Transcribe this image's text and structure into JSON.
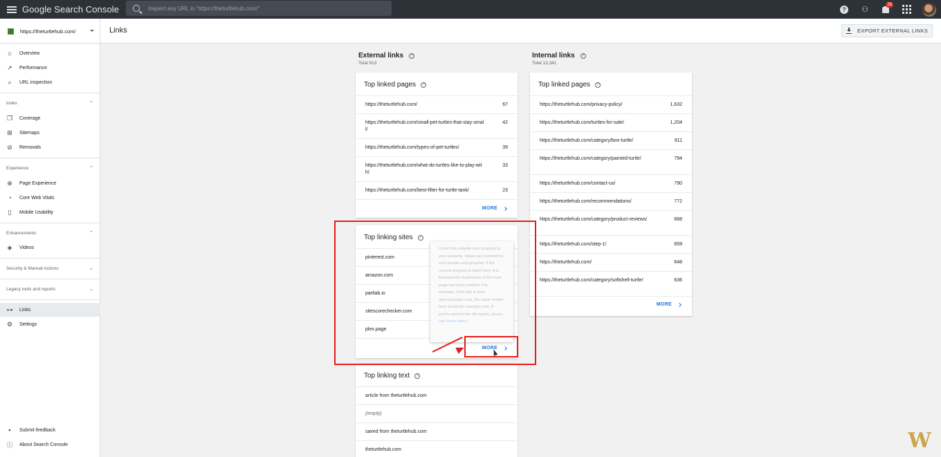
{
  "app": {
    "brand": "Google Search Console",
    "search_placeholder": "Inspect any URL in \"https://theturtlehub.com/\"",
    "notification_count": "28"
  },
  "property": "https://theturtlehub.com/",
  "page_title": "Links",
  "export_label": "EXPORT EXTERNAL LINKS",
  "sidebar": {
    "top_items": [
      {
        "label": "Overview",
        "icon": "home-icon"
      },
      {
        "label": "Performance",
        "icon": "trending-icon"
      },
      {
        "label": "URL inspection",
        "icon": "search-icon"
      }
    ],
    "sections": [
      {
        "title": "Index",
        "items": [
          "Coverage",
          "Sitemaps",
          "Removals"
        ]
      },
      {
        "title": "Experience",
        "items": [
          "Page Experience",
          "Core Web Vitals",
          "Mobile Usability"
        ]
      },
      {
        "title": "Enhancements",
        "items": [
          "Videos"
        ]
      }
    ],
    "collapsed_sections": [
      "Security & Manual Actions",
      "Legacy tools and reports"
    ],
    "bottom_items": [
      "Links",
      "Settings"
    ],
    "footer_items": [
      "Submit feedback",
      "About Search Console"
    ]
  },
  "external": {
    "title": "External links",
    "total": "Total 913",
    "top_linked_pages": {
      "title": "Top linked pages",
      "rows": [
        {
          "url": "https://theturtlehub.com/",
          "count": "67"
        },
        {
          "url": "https://theturtlehub.com/small-pet-turtles-that-stay-small/",
          "count": "42"
        },
        {
          "url": "https://theturtlehub.com/types-of-pet-turtles/",
          "count": "39"
        },
        {
          "url": "https://theturtlehub.com/what-do-turtles-like-to-play-with/",
          "count": "33"
        },
        {
          "url": "https://theturtlehub.com/best-filter-for-turtle-tank/",
          "count": "23"
        }
      ]
    },
    "top_linking_sites": {
      "title": "Top linking sites",
      "rows": [
        "pinterest.com",
        "amazon.com",
        "partlab.io",
        "sitescorechecker.com",
        "plex.page"
      ]
    },
    "top_linking_text": {
      "title": "Top linking text",
      "rows": [
        "article from theturtlehub.com",
        "(empty)",
        "saved from theturtlehub.com",
        "theturtlehub.com"
      ]
    }
  },
  "internal": {
    "title": "Internal links",
    "total": "Total 13,341",
    "top_linked_pages": {
      "title": "Top linked pages",
      "rows": [
        {
          "url": "https://theturtlehub.com/privacy-policy/",
          "count": "1,632"
        },
        {
          "url": "https://theturtlehub.com/turtles-for-sale/",
          "count": "1,204"
        },
        {
          "url": "https://theturtlehub.com/category/box-turtle/",
          "count": "811"
        },
        {
          "url": "https://theturtlehub.com/category/painted-turtle/",
          "count": "794"
        },
        {
          "url": "https://theturtlehub.com/contact-us/",
          "count": "790"
        },
        {
          "url": "https://theturtlehub.com/recommendations/",
          "count": "772"
        },
        {
          "url": "https://theturtlehub.com/category/product-reviews/",
          "count": "668"
        },
        {
          "url": "https://theturtlehub.com/step-1/",
          "count": "659"
        },
        {
          "url": "https://theturtlehub.com/",
          "count": "648"
        },
        {
          "url": "https://theturtlehub.com/category/softshell-turtle/",
          "count": "636"
        }
      ]
    }
  },
  "more_label": "MORE",
  "tooltip": {
    "text": "Links from outside your property to your property. Values are trimmed to root domain and grouped. If the current property is listed here, it is because the subdomain of the host page has been omitted. For example, if the link is from www.example.com, the value shown here would be example.com. If you're used to the old report,",
    "link": "please see these notes."
  },
  "watermark": "W"
}
